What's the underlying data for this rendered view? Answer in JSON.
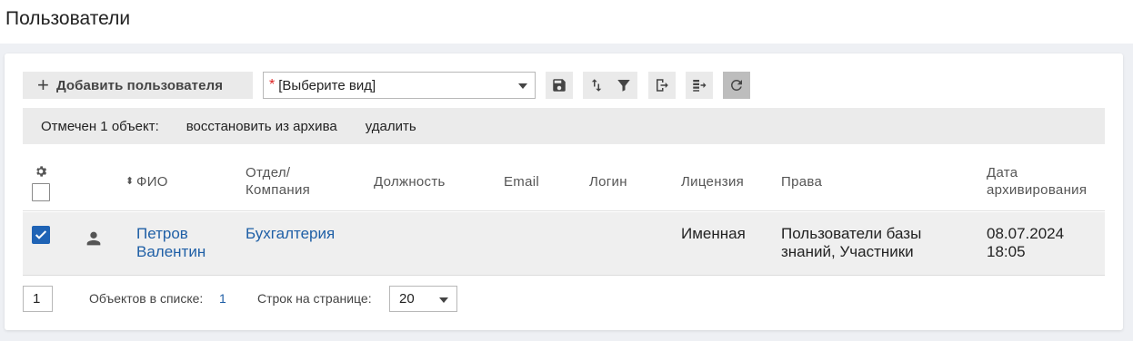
{
  "page": {
    "title": "Пользователи"
  },
  "toolbar": {
    "add_label": "Добавить пользователя",
    "view_select": {
      "required_mark": "*",
      "value": "[Выберите вид]"
    },
    "buttons": [
      "save-icon",
      "sort-icon",
      "filter-icon",
      "export-icon",
      "export-list-icon",
      "refresh-icon"
    ]
  },
  "selection": {
    "count_text": "Отмечен 1 объект:",
    "restore_label": "восстановить из архива",
    "delete_label": "удалить"
  },
  "table": {
    "columns": {
      "name": "ФИО",
      "dept_line1": "Отдел/",
      "dept_line2": "Компания",
      "position": "Должность",
      "email": "Email",
      "login": "Логин",
      "license": "Лицензия",
      "rights": "Права",
      "date_line1": "Дата",
      "date_line2": "архивирования"
    },
    "rows": [
      {
        "checked": true,
        "name_line1": "Петров",
        "name_line2": "Валентин",
        "dept": "Бухгалтерия",
        "position": "",
        "email": "",
        "login": "",
        "license": "Именная",
        "rights_line1": "Пользователи базы",
        "rights_line2": "знаний, Участники",
        "date_line1": "08.07.2024",
        "date_line2": "18:05"
      }
    ]
  },
  "footer": {
    "page": "1",
    "objects_label": "Объектов в списке:",
    "objects_count": "1",
    "rows_label": "Строк на странице:",
    "rows_per_page": "20"
  },
  "colors": {
    "accent": "#1f63b5",
    "link": "#1f5fa6",
    "required": "#dd2222"
  }
}
